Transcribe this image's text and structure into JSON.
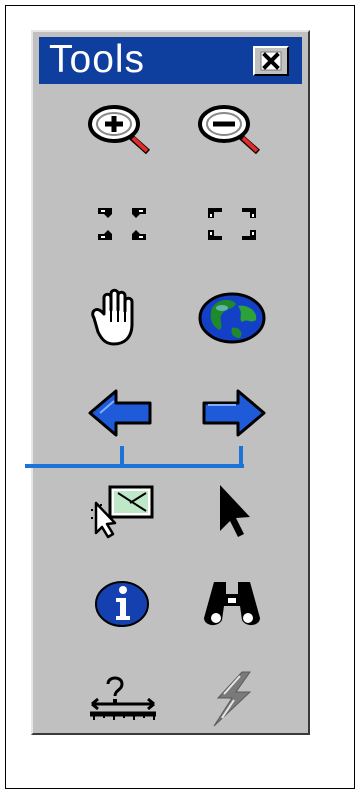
{
  "window": {
    "title": "Tools",
    "close_icon": "close-icon"
  },
  "tools": [
    {
      "name": "zoom-in-tool",
      "icon": "zoom-in-icon"
    },
    {
      "name": "zoom-out-tool",
      "icon": "zoom-out-icon"
    },
    {
      "name": "fixed-zoom-in-tool",
      "icon": "fixed-zoom-in-icon"
    },
    {
      "name": "fixed-zoom-out-tool",
      "icon": "fixed-zoom-out-icon"
    },
    {
      "name": "pan-tool",
      "icon": "hand-icon"
    },
    {
      "name": "full-extent-tool",
      "icon": "globe-icon"
    },
    {
      "name": "go-back-tool",
      "icon": "arrow-left-icon"
    },
    {
      "name": "go-forward-tool",
      "icon": "arrow-right-icon"
    },
    {
      "name": "select-features-tool",
      "icon": "select-features-icon"
    },
    {
      "name": "select-elements-tool",
      "icon": "arrow-pointer-icon"
    },
    {
      "name": "identify-tool",
      "icon": "info-icon"
    },
    {
      "name": "find-tool",
      "icon": "binoculars-icon"
    },
    {
      "name": "measure-tool",
      "icon": "measure-icon"
    },
    {
      "name": "hyperlink-tool",
      "icon": "lightning-icon"
    }
  ],
  "colors": {
    "toolbar_bg": "#c0c0c0",
    "titlebar_bg": "#0f3f9e",
    "arrow_blue": "#1f5bd8",
    "annotation_line": "#1e73d6"
  }
}
